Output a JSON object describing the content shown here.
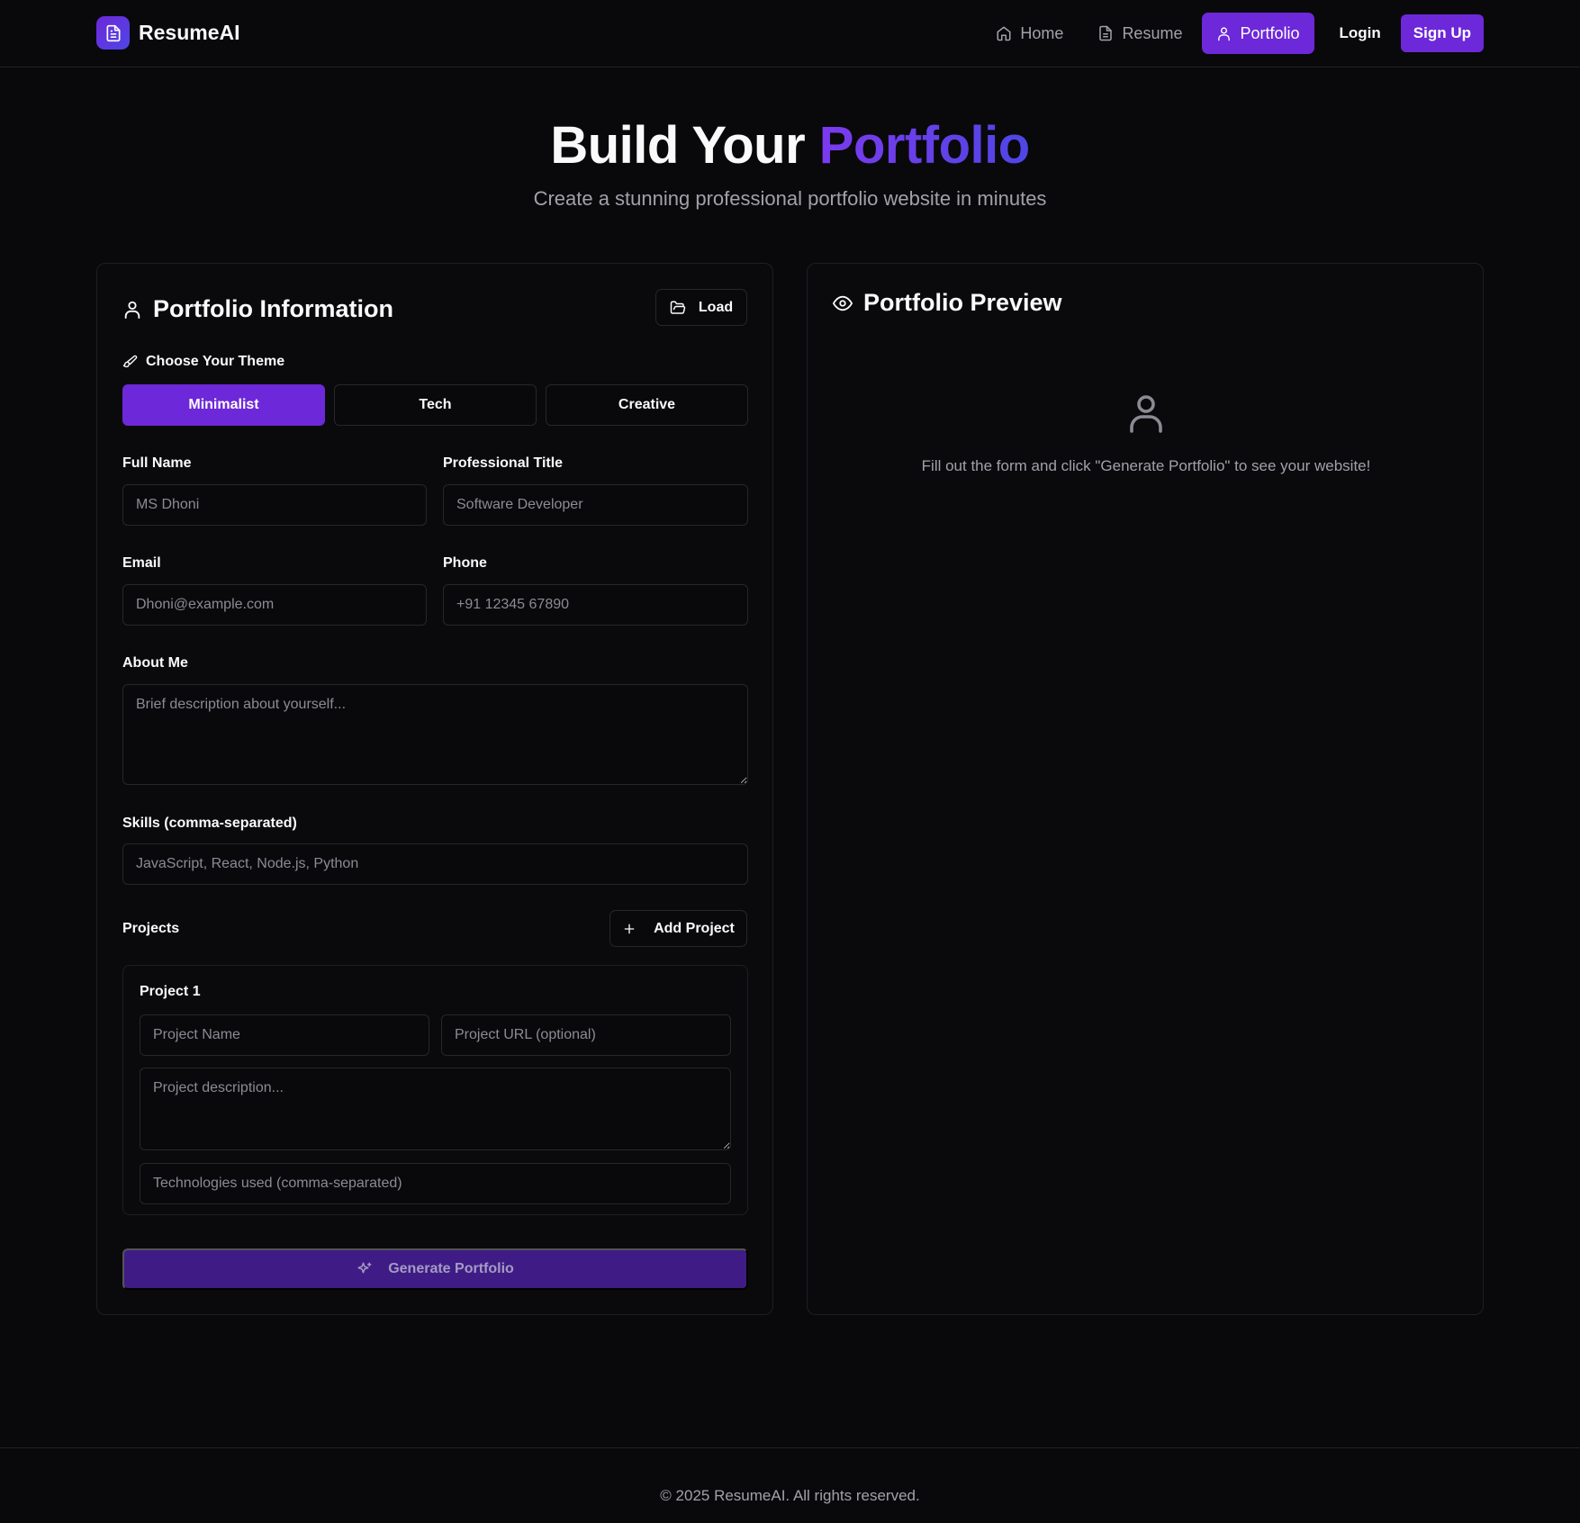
{
  "nav": {
    "brand": "ResumeAI",
    "links": [
      {
        "label": "Home",
        "icon": "home-icon"
      },
      {
        "label": "Resume",
        "icon": "file-icon"
      },
      {
        "label": "Portfolio",
        "icon": "user-icon",
        "active": true
      }
    ],
    "login": "Login",
    "signup": "Sign Up"
  },
  "hero": {
    "title_prefix": "Build Your ",
    "title_accent": "Portfolio",
    "subtitle": "Create a stunning professional portfolio website in minutes"
  },
  "form": {
    "title": "Portfolio Information",
    "load_label": "Load",
    "theme_label": "Choose Your Theme",
    "themes": [
      "Minimalist",
      "Tech",
      "Creative"
    ],
    "selected_theme": "Minimalist",
    "full_name": {
      "label": "Full Name",
      "placeholder": "MS Dhoni",
      "value": ""
    },
    "title_field": {
      "label": "Professional Title",
      "placeholder": "Software Developer",
      "value": ""
    },
    "email": {
      "label": "Email",
      "placeholder": "Dhoni@example.com",
      "value": ""
    },
    "phone": {
      "label": "Phone",
      "placeholder": "+91 12345 67890",
      "value": ""
    },
    "about": {
      "label": "About Me",
      "placeholder": "Brief description about yourself...",
      "value": ""
    },
    "skills": {
      "label": "Skills (comma-separated)",
      "placeholder": "JavaScript, React, Node.js, Python",
      "value": ""
    },
    "projects_label": "Projects",
    "add_project_label": "Add Project",
    "project": {
      "title": "Project 1",
      "name_placeholder": "Project Name",
      "url_placeholder": "Project URL (optional)",
      "description_placeholder": "Project description...",
      "tech_placeholder": "Technologies used (comma-separated)"
    },
    "generate_label": "Generate Portfolio"
  },
  "preview": {
    "title": "Portfolio Preview",
    "empty_message": "Fill out the form and click \"Generate Portfolio\" to see your website!"
  },
  "footer": {
    "text": "© 2025 ResumeAI. All rights reserved."
  },
  "colors": {
    "background": "#09090b",
    "accent": "#6d28d9",
    "accent_gradient_end": "#4f46e5",
    "border": "#27272a",
    "muted_text": "#a1a1aa"
  }
}
